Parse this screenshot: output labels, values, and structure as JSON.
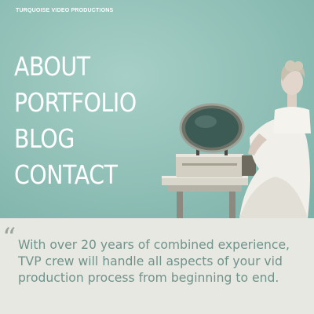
{
  "brand": {
    "name": "TURQUOISE VIDEO PRODUCTIONS"
  },
  "nav": {
    "items": [
      {
        "label": "ABOUT"
      },
      {
        "label": "PORTFOLIO"
      },
      {
        "label": "BLOG"
      },
      {
        "label": "CONTACT"
      }
    ]
  },
  "quote": {
    "mark": "“",
    "lines": [
      "With over 20 years of combined experience,",
      "TVP crew will handle all aspects of your vid",
      "production process from beginning to end."
    ]
  },
  "colors": {
    "hero_background": "#8fbfb6",
    "quote_background": "#e8e8e3",
    "quote_text": "#6f938b",
    "nav_text": "#ffffff"
  }
}
